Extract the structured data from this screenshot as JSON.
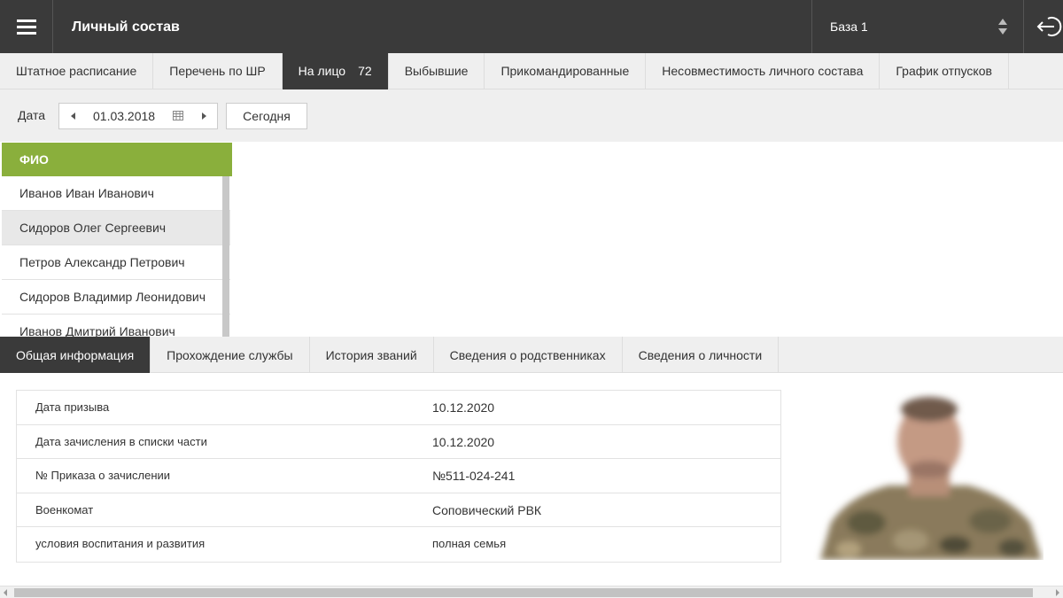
{
  "header": {
    "title": "Личный состав",
    "database_select": "База 1"
  },
  "main_tabs": [
    {
      "label": "Штатное расписание"
    },
    {
      "label": "Перечень по ШР"
    },
    {
      "label": "На лицо",
      "count": "72",
      "active": true
    },
    {
      "label": "Выбывшие"
    },
    {
      "label": "Прикомандированные"
    },
    {
      "label": "Несовместимость личного состава"
    },
    {
      "label": "График отпусков"
    }
  ],
  "date_filter": {
    "label": "Дата",
    "value": "01.03.2018",
    "today_button": "Сегодня"
  },
  "person_list": {
    "header": "ФИО",
    "items": [
      {
        "name": "Иванов Иван Иванович"
      },
      {
        "name": "Сидоров Олег Сергеевич",
        "selected": true
      },
      {
        "name": "Петров Александр Петрович"
      },
      {
        "name": "Сидоров Владимир Леонидович"
      },
      {
        "name": "Иванов Дмитрий Иванович"
      }
    ]
  },
  "detail_tabs": [
    {
      "label": "Общая информация",
      "active": true
    },
    {
      "label": "Прохождение службы"
    },
    {
      "label": "История званий"
    },
    {
      "label": "Сведения о родственниках"
    },
    {
      "label": "Сведения о личности"
    }
  ],
  "general_info": [
    {
      "key": "Дата призыва",
      "value": "10.12.2020"
    },
    {
      "key": "Дата зачисления в списки части",
      "value": "10.12.2020"
    },
    {
      "key": "№ Приказа о зачислении",
      "value": "№511-024-241"
    },
    {
      "key": "Военкомат",
      "value": "Соповический РВК"
    },
    {
      "key": "условия воспитания и развития",
      "value": "полная семья"
    }
  ],
  "colors": {
    "topbar": "#3a3a3a",
    "active_tab": "#3a3a3a",
    "list_header": "#8aaf3c",
    "tab_bar": "#efefef"
  }
}
